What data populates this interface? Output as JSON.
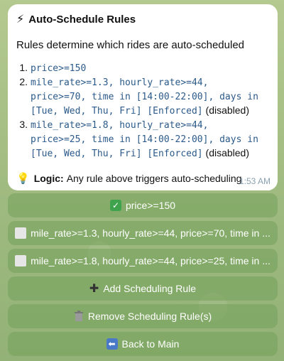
{
  "message": {
    "title": "Auto-Schedule Rules",
    "subtitle": "Rules determine which rides are auto-scheduled",
    "rules": [
      {
        "number": "1.",
        "code": "price>=150",
        "status": ""
      },
      {
        "number": "2.",
        "code": "mile_rate>=1.3, hourly_rate>=44, price>=70, time in [14:00-22:00], days in [Tue, Wed, Thu, Fri] [Enforced]",
        "status": "(disabled)"
      },
      {
        "number": "3.",
        "code": "mile_rate>=1.8, hourly_rate>=44, price>=25, time in [14:00-22:00], days in [Tue, Wed, Thu, Fri] [Enforced]",
        "status": "(disabled)"
      }
    ],
    "logic_label": "Logic:",
    "logic_text": "Any rule above triggers auto-scheduling",
    "time": "1:53 AM"
  },
  "buttons": {
    "rule1": "price>=150",
    "rule2": "mile_rate>=1.3, hourly_rate>=44, price>=70, time in ...",
    "rule3": "mile_rate>=1.8, hourly_rate>=44, price>=25, time in ...",
    "add": "Add Scheduling Rule",
    "remove": "Remove Scheduling Rule(s)",
    "back": "Back to Main"
  },
  "icons": {
    "title": "lightning-icon",
    "logic": "lightbulb-icon",
    "enabled": "checkmark-icon",
    "disabled": "empty-box-icon",
    "add": "plus-icon",
    "remove": "trash-icon",
    "back": "back-arrow-icon"
  },
  "colors": {
    "accent_check": "#3fa34d",
    "code_text": "#2b5a8a",
    "button_bg": "#73a05a"
  }
}
